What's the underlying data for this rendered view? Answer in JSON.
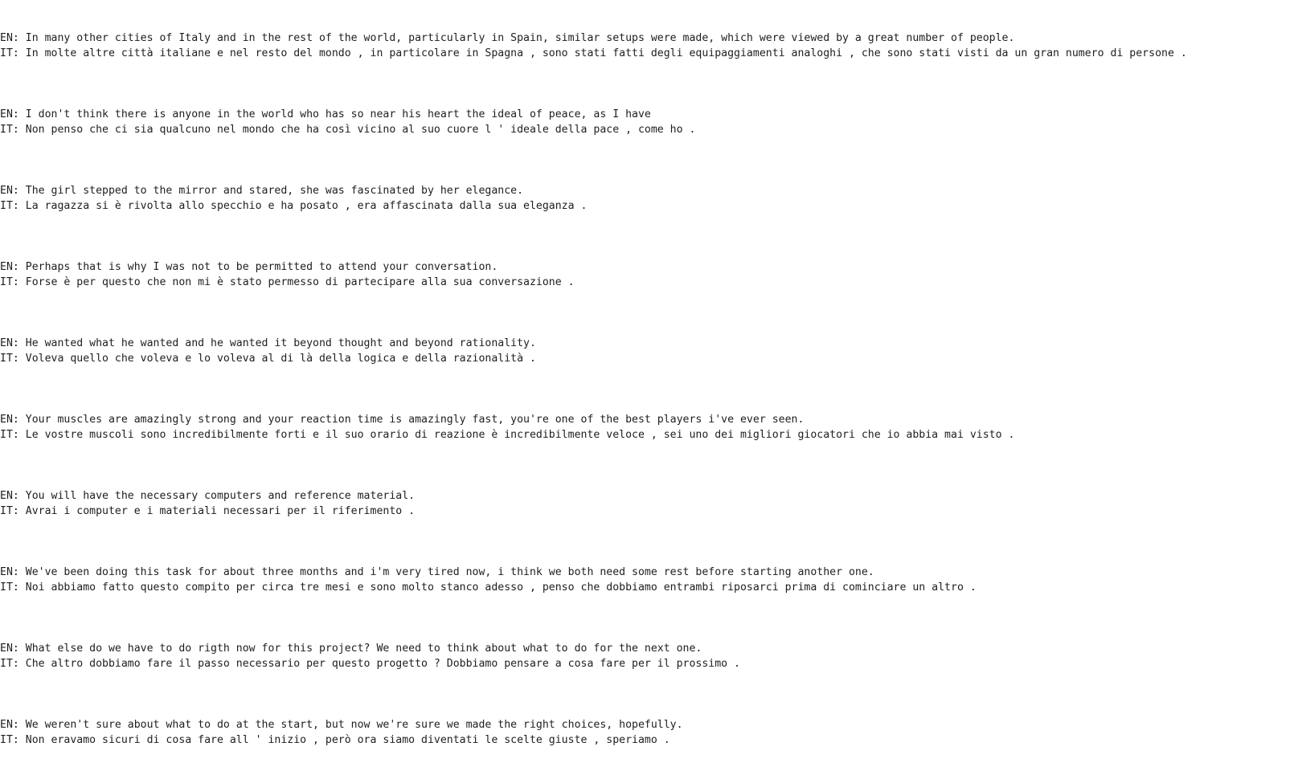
{
  "prefixes": {
    "en": "EN: ",
    "it": "IT: "
  },
  "pairs": [
    {
      "en": "In many other cities of Italy and in the rest of the world, particularly in Spain, similar setups were made, which were viewed by a great number of people.",
      "it": "In molte altre città italiane e nel resto del mondo , in particolare in Spagna , sono stati fatti degli equipaggiamenti analoghi , che sono stati visti da un gran numero di persone ."
    },
    {
      "en": "I don't think there is anyone in the world who has so near his heart the ideal of peace, as I have",
      "it": "Non penso che ci sia qualcuno nel mondo che ha così vicino al suo cuore l ' ideale della pace , come ho ."
    },
    {
      "en": "The girl stepped to the mirror and stared, she was fascinated by her elegance.",
      "it": "La ragazza si è rivolta allo specchio e ha posato , era affascinata dalla sua eleganza ."
    },
    {
      "en": "Perhaps that is why I was not to be permitted to attend your conversation.",
      "it": "Forse è per questo che non mi è stato permesso di partecipare alla sua conversazione ."
    },
    {
      "en": "He wanted what he wanted and he wanted it beyond thought and beyond rationality.",
      "it": "Voleva quello che voleva e lo voleva al di là della logica e della razionalità ."
    },
    {
      "en": "Your muscles are amazingly strong and your reaction time is amazingly fast, you're one of the best players i've ever seen.",
      "it": "Le vostre muscoli sono incredibilmente forti e il suo orario di reazione è incredibilmente veloce , sei uno dei migliori giocatori che io abbia mai visto ."
    },
    {
      "en": "You will have the necessary computers and reference material.",
      "it": "Avrai i computer e i materiali necessari per il riferimento ."
    },
    {
      "en": "We've been doing this task for about three months and i'm very tired now, i think we both need some rest before starting another one.",
      "it": "Noi abbiamo fatto questo compito per circa tre mesi e sono molto stanco adesso , penso che dobbiamo entrambi riposarci prima di cominciare un altro ."
    },
    {
      "en": "What else do we have to do rigth now for this project? We need to think about what to do for the next one.",
      "it": "Che altro dobbiamo fare il passo necessario per questo progetto ? Dobbiamo pensare a cosa fare per il prossimo ."
    },
    {
      "en": "We weren't sure about what to do at the start, but now we're sure we made the right choices, hopefully.",
      "it": "Non eravamo sicuri di cosa fare all ' inizio , però ora siamo diventati le scelte giuste , speriamo ."
    }
  ]
}
